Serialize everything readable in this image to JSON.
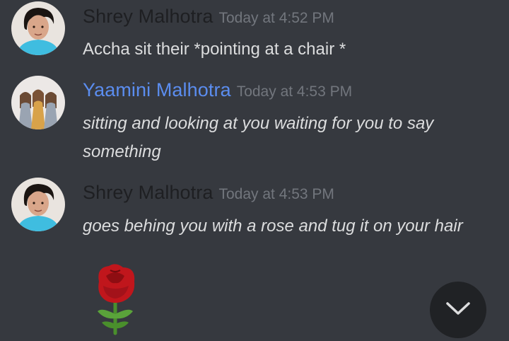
{
  "messages": [
    {
      "author": "Shrey Malhotra",
      "author_color": "#1e1f22",
      "timestamp": "Today at 4:52 PM",
      "content": "Accha sit their *pointing at a chair *"
    },
    {
      "author": "Yaamini Malhotra",
      "author_color": "#5b8def",
      "timestamp": "Today at 4:53 PM",
      "content": "sitting and looking at you waiting for you to say something"
    },
    {
      "author": "Shrey Malhotra",
      "author_color": "#1e1f22",
      "timestamp": "Today at 4:53 PM",
      "content": "goes behing you with a rose and tug it on your hair",
      "emoji": "rose-emoji"
    }
  ],
  "scroll_button": {
    "icon": "chevron-down-icon"
  }
}
